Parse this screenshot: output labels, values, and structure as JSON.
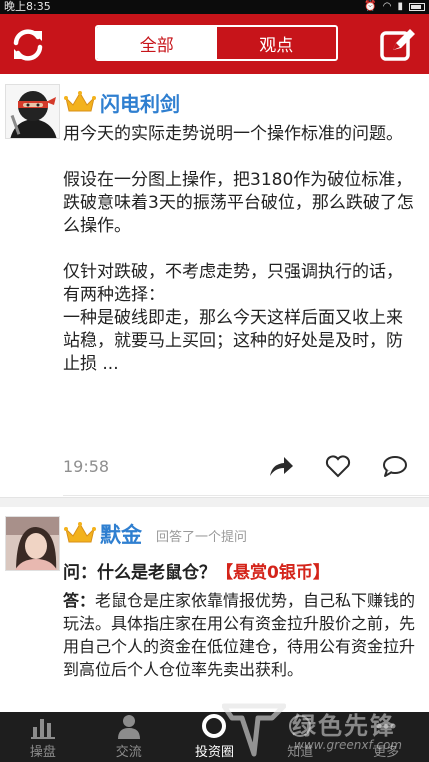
{
  "status_bar": {
    "time": "晚上8:35"
  },
  "header": {
    "tabs": [
      {
        "label": "全部",
        "active": true
      },
      {
        "label": "观点",
        "active": false
      }
    ],
    "accent_color": "#c7141a"
  },
  "posts": [
    {
      "username": "闪电利剑",
      "paragraphs": [
        "用今天的实际走势说明一个操作标准的问题。",
        "",
        "假设在一分图上操作，把3180作为破位标准，跌破意味着3天的振荡平台破位，那么跌破了怎么操作。",
        "",
        "仅针对跌破，不考虑走势，只强调执行的话，有两种选择：",
        "一种是破线即走，那么今天这样后面又收上来站稳，就要马上买回；这种的好处是及时，防止损 ..."
      ],
      "time": "19:58"
    },
    {
      "username": "默金",
      "note": "回答了一个提问",
      "question": "问：什么是老鼠仓？",
      "bounty": "【悬赏0银币】",
      "answer_label": "答：",
      "answer": "老鼠仓是庄家依靠情报优势，自己私下赚钱的玩法。具体指庄家在用公有资金拉升股价之前，先用自己个人的资金在低位建仓，待用公有资金拉升到高位后个人仓位率先卖出获利。"
    }
  ],
  "tab_bar": {
    "items": [
      {
        "label": "操盘",
        "icon": "chart-bars-icon",
        "active": false
      },
      {
        "label": "交流",
        "icon": "person-icon",
        "active": false
      },
      {
        "label": "投资圈",
        "icon": "circle-icon",
        "active": true
      },
      {
        "label": "知道",
        "icon": "question-icon",
        "active": false
      },
      {
        "label": "更多",
        "icon": "more-icon",
        "active": false
      }
    ]
  },
  "watermark": {
    "title": "绿色先锋",
    "url": "www.greenxf.com"
  }
}
